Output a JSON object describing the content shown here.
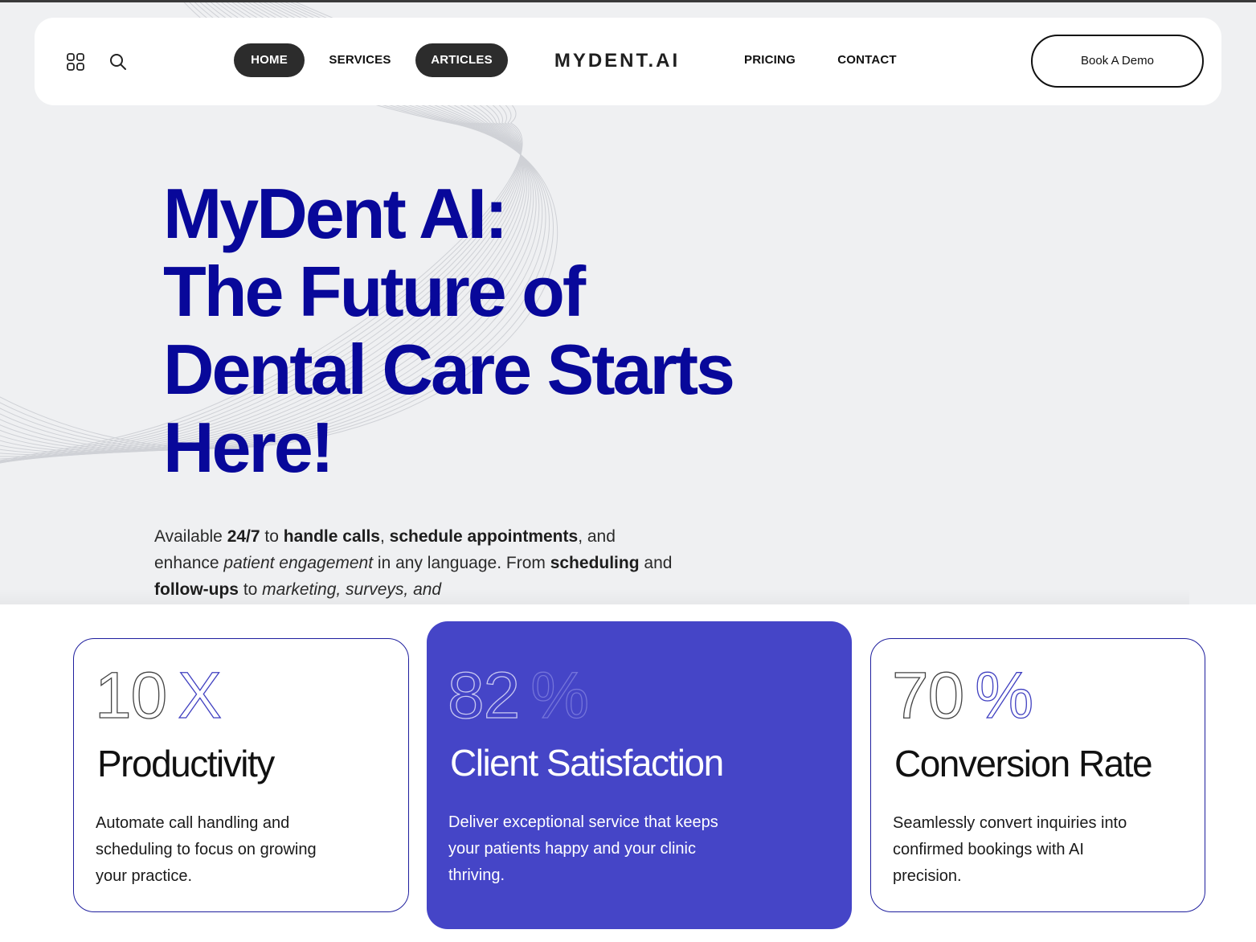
{
  "nav": {
    "menu_icon": "grid-icon",
    "search_icon": "search-icon",
    "items": [
      {
        "label": "HOME",
        "active": true
      },
      {
        "label": "SERVICES",
        "active": false
      },
      {
        "label": "ARTICLES",
        "active": true
      },
      {
        "label": "PRICING",
        "active": false
      },
      {
        "label": "CONTACT",
        "active": false
      }
    ],
    "logo": "MYDENT.AI",
    "cta": "Book A Demo"
  },
  "hero": {
    "headline": [
      "MyDent AI:",
      "The Future of",
      "Dental Care Starts",
      "Here!"
    ],
    "intro": {
      "t1": "Available ",
      "b1": "24/7",
      "t2": " to ",
      "b2": "handle calls",
      "t3": ", ",
      "b3": "schedule appointments",
      "t4": ", and enhance ",
      "i1": "patient engagement",
      "t5": " in any language. From ",
      "b4": "scheduling",
      "t6": " and ",
      "b5": "follow-ups",
      "t7": " to ",
      "i2": "marketing, surveys, and"
    },
    "accent_color": "#08089a"
  },
  "stats": [
    {
      "value": "10",
      "unit": "X",
      "title": "Productivity",
      "description": "Automate call handling and scheduling to focus on growing your practice.",
      "featured": false
    },
    {
      "value": "82",
      "unit": "%",
      "title": "Client Satisfaction",
      "description": "Deliver exceptional service that keeps your patients happy and your clinic thriving.",
      "featured": true
    },
    {
      "value": "70",
      "unit": "%",
      "title": "Conversion Rate",
      "description": "Seamlessly convert inquiries into confirmed bookings with AI precision.",
      "featured": false
    }
  ],
  "colors": {
    "featured_card": "#4545c7",
    "card_border": "#1f1f9e",
    "nav_active": "#2c2c2c"
  }
}
